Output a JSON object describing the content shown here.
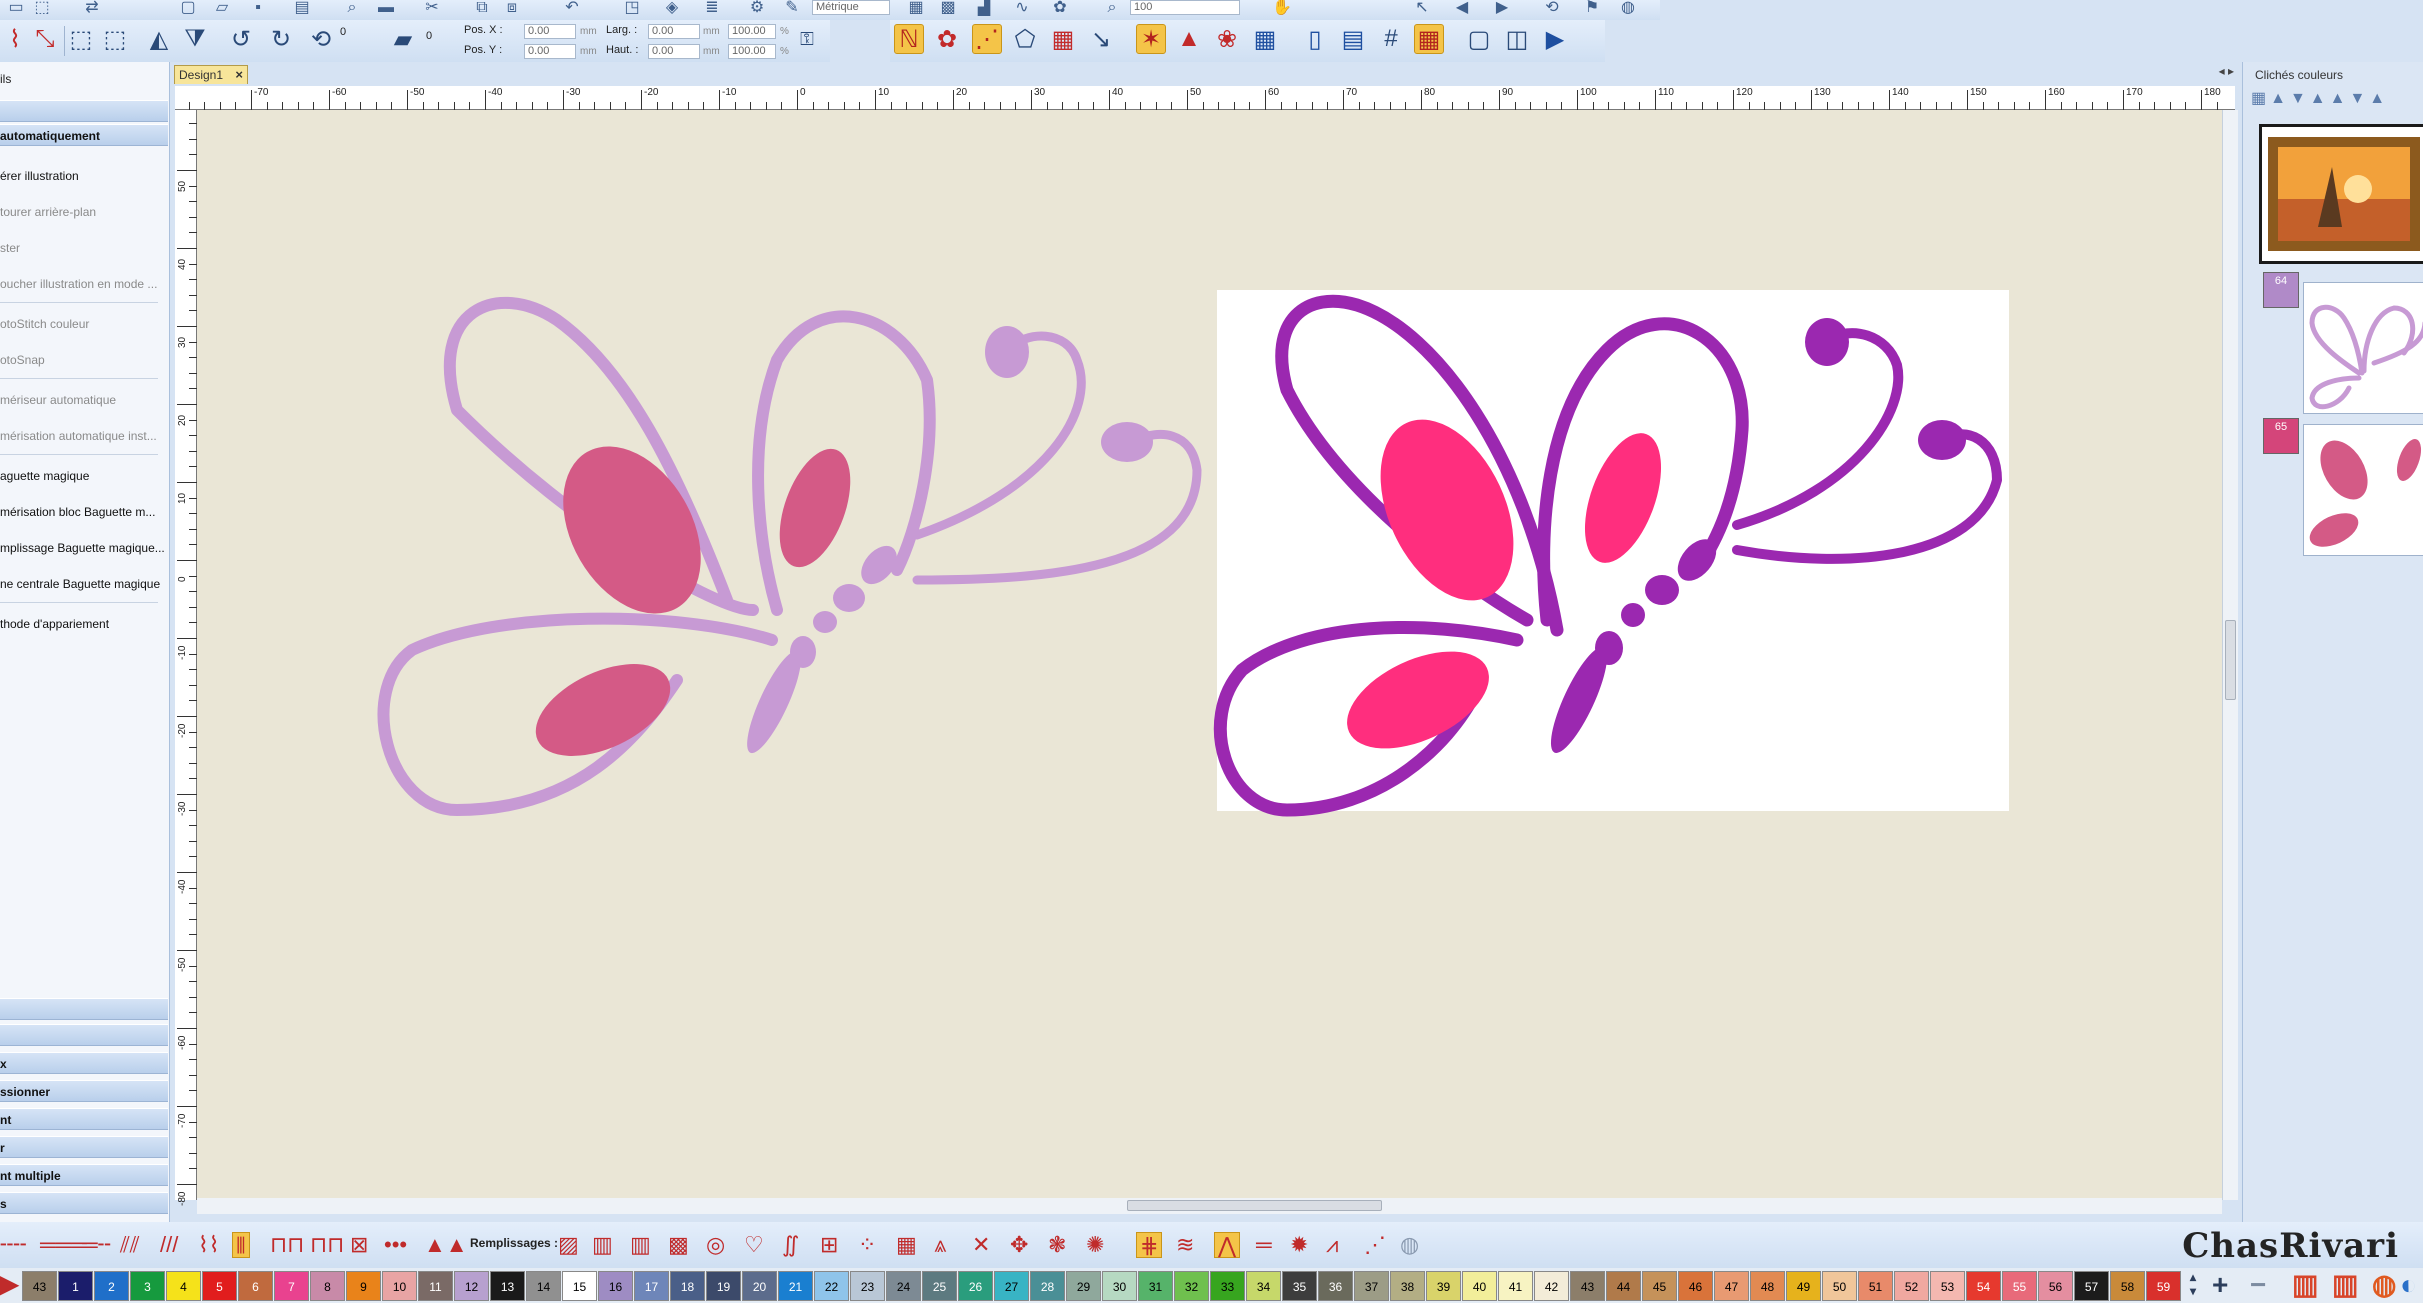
{
  "toolbar": {
    "posx_label": "Pos. X :",
    "posy_label": "Pos. Y :",
    "posx_value": "0.00",
    "posy_value": "0.00",
    "width_label": "Larg. :",
    "height_label": "Haut. :",
    "width_value": "0.00",
    "height_value": "0.00",
    "width_pct": "100.00",
    "height_pct": "100.00",
    "unit_mm": "mm",
    "unit_pct": "%",
    "rotate_value": "0",
    "rotate_value2": "0",
    "unit_select": "Métrique",
    "zoom_value": "100"
  },
  "tabs": [
    {
      "label": "Design1"
    }
  ],
  "left_panel": {
    "title": "ils",
    "active_section": "automatiquement",
    "items": [
      {
        "label": "érer illustration",
        "enabled": true
      },
      {
        "label": "tourer arrière-plan",
        "enabled": false
      },
      {
        "label": "ster",
        "enabled": false
      },
      {
        "label": "oucher illustration en mode ...",
        "enabled": false
      },
      {
        "label": "otoStitch couleur",
        "enabled": false
      },
      {
        "label": "otoSnap",
        "enabled": false
      },
      {
        "label": "mériseur automatique",
        "enabled": false
      },
      {
        "label": "mérisation automatique inst...",
        "enabled": false
      },
      {
        "label": "aguette magique",
        "enabled": true
      },
      {
        "label": "mérisation bloc Baguette m...",
        "enabled": true
      },
      {
        "label": "mplissage Baguette magique...",
        "enabled": true
      },
      {
        "label": "ne centrale Baguette magique",
        "enabled": true
      },
      {
        "label": "thode d'appariement",
        "enabled": true
      }
    ],
    "bottom_sections": [
      "",
      "",
      "x",
      "ssionner",
      "nt",
      "r",
      "nt multiple",
      "s"
    ]
  },
  "ruler": {
    "x_labels": [
      "-70",
      "-60",
      "-50",
      "-40",
      "-30",
      "-20",
      "-10",
      "0",
      "10",
      "20",
      "30",
      "40",
      "50",
      "60",
      "70",
      "80",
      "90",
      "100",
      "110",
      "120",
      "130",
      "140",
      "150",
      "160",
      "170",
      "180"
    ],
    "y_labels": [
      "50",
      "40",
      "30",
      "20",
      "10",
      "0",
      "-10",
      "-20",
      "-30",
      "-40",
      "-50",
      "-60",
      "-70",
      "-80"
    ]
  },
  "right_panel": {
    "title": "Clichés couleurs",
    "badges": [
      {
        "label": "64",
        "color": "#b08ac8"
      },
      {
        "label": "65",
        "color": "#d4457a"
      }
    ]
  },
  "stitch_bar": {
    "fills_label": "Remplissages :",
    "brand": "ChasRivari"
  },
  "palette": {
    "swatches": [
      {
        "label": "43",
        "color": "#8c7e6a",
        "text": "#000"
      },
      {
        "label": "1",
        "color": "#1b1d6b",
        "text": "#fff"
      },
      {
        "label": "2",
        "color": "#1f6fc9",
        "text": "#fff"
      },
      {
        "label": "3",
        "color": "#169a3e",
        "text": "#fff"
      },
      {
        "label": "4",
        "color": "#f5e21a",
        "text": "#000"
      },
      {
        "label": "5",
        "color": "#e11d1d",
        "text": "#fff"
      },
      {
        "label": "6",
        "color": "#c06a3e",
        "text": "#fff"
      },
      {
        "label": "7",
        "color": "#e9428f",
        "text": "#fff"
      },
      {
        "label": "8",
        "color": "#c88aa8",
        "text": "#000"
      },
      {
        "label": "9",
        "color": "#e9831a",
        "text": "#000"
      },
      {
        "label": "10",
        "color": "#e8a4a4",
        "text": "#000"
      },
      {
        "label": "11",
        "color": "#7a6a66",
        "text": "#fff"
      },
      {
        "label": "12",
        "color": "#b7a0cf",
        "text": "#000"
      },
      {
        "label": "13",
        "color": "#1a1a1a",
        "text": "#fff"
      },
      {
        "label": "14",
        "color": "#909090",
        "text": "#000"
      },
      {
        "label": "15",
        "color": "#ffffff",
        "text": "#000"
      },
      {
        "label": "16",
        "color": "#9e8cc3",
        "text": "#000"
      },
      {
        "label": "17",
        "color": "#6e86b9",
        "text": "#fff"
      },
      {
        "label": "18",
        "color": "#4a5f88",
        "text": "#fff"
      },
      {
        "label": "19",
        "color": "#3c4a6a",
        "text": "#fff"
      },
      {
        "label": "20",
        "color": "#5c6c8c",
        "text": "#fff"
      },
      {
        "label": "21",
        "color": "#1a7fd0",
        "text": "#fff"
      },
      {
        "label": "22",
        "color": "#8fc4ea",
        "text": "#000"
      },
      {
        "label": "23",
        "color": "#b9c7d6",
        "text": "#000"
      },
      {
        "label": "24",
        "color": "#7d8a94",
        "text": "#000"
      },
      {
        "label": "25",
        "color": "#5d7a80",
        "text": "#fff"
      },
      {
        "label": "26",
        "color": "#2a9d7d",
        "text": "#fff"
      },
      {
        "label": "27",
        "color": "#38b4c4",
        "text": "#000"
      },
      {
        "label": "28",
        "color": "#4a8f96",
        "text": "#fff"
      },
      {
        "label": "29",
        "color": "#8fa89c",
        "text": "#000"
      },
      {
        "label": "30",
        "color": "#b6d9c2",
        "text": "#000"
      },
      {
        "label": "31",
        "color": "#56b36a",
        "text": "#000"
      },
      {
        "label": "32",
        "color": "#6fc04e",
        "text": "#000"
      },
      {
        "label": "33",
        "color": "#37a51f",
        "text": "#000"
      },
      {
        "label": "34",
        "color": "#c6d86a",
        "text": "#000"
      },
      {
        "label": "35",
        "color": "#3d3d3d",
        "text": "#fff"
      },
      {
        "label": "36",
        "color": "#6a6a5c",
        "text": "#fff"
      },
      {
        "label": "37",
        "color": "#9c9c86",
        "text": "#000"
      },
      {
        "label": "38",
        "color": "#b3ae84",
        "text": "#000"
      },
      {
        "label": "39",
        "color": "#d9d36a",
        "text": "#000"
      },
      {
        "label": "40",
        "color": "#f2ee9a",
        "text": "#000"
      },
      {
        "label": "41",
        "color": "#f7f3c2",
        "text": "#000"
      },
      {
        "label": "42",
        "color": "#f3ecd8",
        "text": "#000"
      },
      {
        "label": "43",
        "color": "#8c7e6a",
        "text": "#000"
      },
      {
        "label": "44",
        "color": "#b07a4a",
        "text": "#000"
      },
      {
        "label": "45",
        "color": "#c5925a",
        "text": "#000"
      },
      {
        "label": "46",
        "color": "#d9733a",
        "text": "#000"
      },
      {
        "label": "47",
        "color": "#e89a72",
        "text": "#000"
      },
      {
        "label": "48",
        "color": "#e28a52",
        "text": "#000"
      },
      {
        "label": "49",
        "color": "#e6b21c",
        "text": "#000"
      },
      {
        "label": "50",
        "color": "#f0c69a",
        "text": "#000"
      },
      {
        "label": "51",
        "color": "#e88a6a",
        "text": "#000"
      },
      {
        "label": "52",
        "color": "#f0a8a0",
        "text": "#000"
      },
      {
        "label": "53",
        "color": "#f4b8b0",
        "text": "#000"
      },
      {
        "label": "54",
        "color": "#e6392e",
        "text": "#fff"
      },
      {
        "label": "55",
        "color": "#e86a7a",
        "text": "#fff"
      },
      {
        "label": "56",
        "color": "#e48ea0",
        "text": "#000"
      },
      {
        "label": "57",
        "color": "#1c1c1c",
        "text": "#fff"
      },
      {
        "label": "58",
        "color": "#c98a3a",
        "text": "#000"
      },
      {
        "label": "59",
        "color": "#d9302c",
        "text": "#fff"
      }
    ]
  },
  "colors": {
    "canvas": "#eae6d6",
    "embroidery_outline": "#c79ad4",
    "embroidery_fill": "#d45a86",
    "artwork_outline": "#9b28b0",
    "artwork_fill": "#ff2e7e"
  }
}
